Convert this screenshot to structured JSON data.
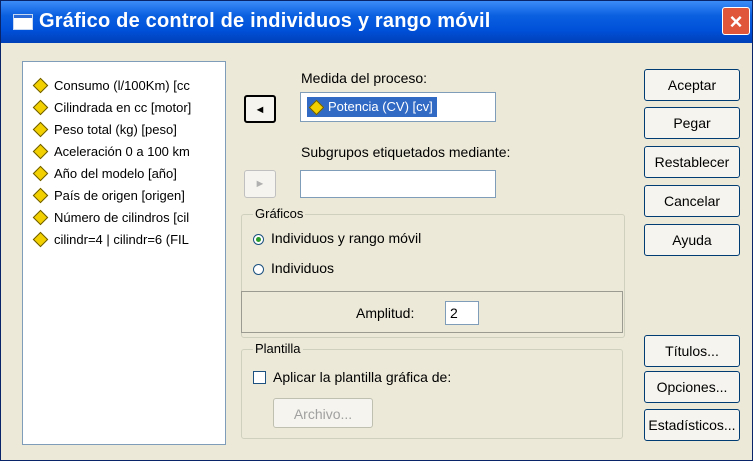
{
  "window": {
    "title": "Gráfico de control de individuos y rango móvil",
    "close_label": "×"
  },
  "variables": [
    {
      "label": "Consumo (l/100Km) [cc",
      "icon": "scale-diamond-icon"
    },
    {
      "label": "Cilindrada en cc [motor]",
      "icon": "scale-diamond-icon"
    },
    {
      "label": "Peso total (kg) [peso]",
      "icon": "scale-diamond-icon"
    },
    {
      "label": "Aceleración 0 a 100 km",
      "icon": "scale-diamond-icon"
    },
    {
      "label": "Año del modelo [año]",
      "icon": "scale-diamond-icon"
    },
    {
      "label": "País de origen [origen]",
      "icon": "scale-diamond-icon"
    },
    {
      "label": "Número de cilindros [cil",
      "icon": "scale-diamond-icon"
    },
    {
      "label": "cilindr=4 | cilindr=6 (FIL",
      "icon": "scale-diamond-icon"
    }
  ],
  "process_measure": {
    "label": "Medida del proceso:",
    "value": "Potencia (CV) [cv]"
  },
  "subgroups": {
    "label": "Subgrupos etiquetados mediante:",
    "value": ""
  },
  "arrows": {
    "move_left": "◄",
    "move_right": "►"
  },
  "graphs": {
    "title": "Gráficos",
    "options": [
      {
        "label": "Individuos y rango móvil",
        "checked": true
      },
      {
        "label": "Individuos",
        "checked": false
      }
    ],
    "span_label": "Amplitud:",
    "span_value": "2"
  },
  "template": {
    "title": "Plantilla",
    "checkbox_label": "Aplicar la plantilla gráfica de:",
    "checked": false,
    "file_button": "Archivo..."
  },
  "buttons": {
    "accept": "Aceptar",
    "paste": "Pegar",
    "reset": "Restablecer",
    "cancel": "Cancelar",
    "help": "Ayuda",
    "titles": "Títulos...",
    "options": "Opciones...",
    "statistics": "Estadísticos..."
  },
  "colors": {
    "titlebar": "#0050d8",
    "dialog_bg": "#ece9d8",
    "selection": "#316ac5",
    "close": "#e0563a"
  }
}
